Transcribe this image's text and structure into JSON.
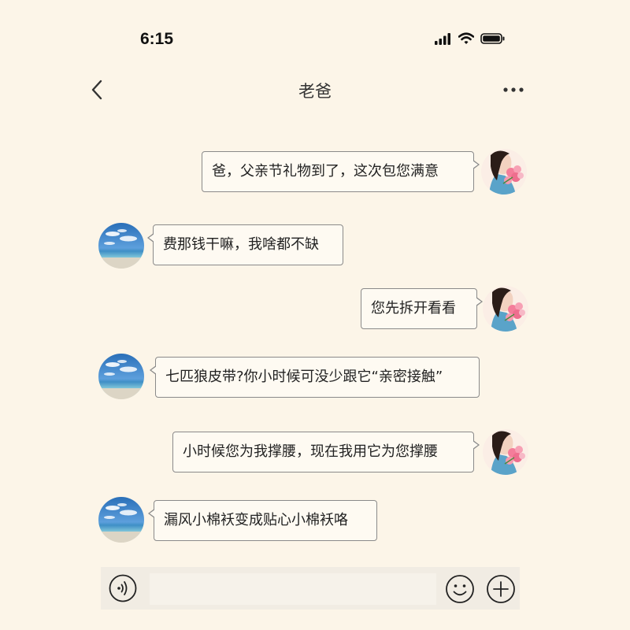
{
  "status_bar": {
    "time": "6:15",
    "icons": [
      "signal-icon",
      "wifi-icon",
      "battery-icon"
    ]
  },
  "nav": {
    "title": "老爸",
    "back_icon": "chevron-left-icon",
    "more_icon": "more-dots-icon"
  },
  "messages": [
    {
      "sender": "me",
      "text": "爸，父亲节礼物到了，这次包您满意"
    },
    {
      "sender": "dad",
      "text": "费那钱干嘛，我啥都不缺"
    },
    {
      "sender": "me",
      "text": "您先拆开看看"
    },
    {
      "sender": "dad",
      "text": "七匹狼皮带?你小时候可没少跟它“亲密接触”"
    },
    {
      "sender": "me",
      "text": "小时候您为我撑腰，现在我用它为您撑腰"
    },
    {
      "sender": "dad",
      "text": "漏风小棉袄变成贴心小棉袄咯"
    }
  ],
  "input_bar": {
    "value": "",
    "icons": [
      "voice-icon",
      "emoji-icon",
      "plus-icon"
    ]
  },
  "colors": {
    "background": "#fcf5e8",
    "bubble_border": "#8a8a8a",
    "input_bar": "#f1ece3"
  }
}
